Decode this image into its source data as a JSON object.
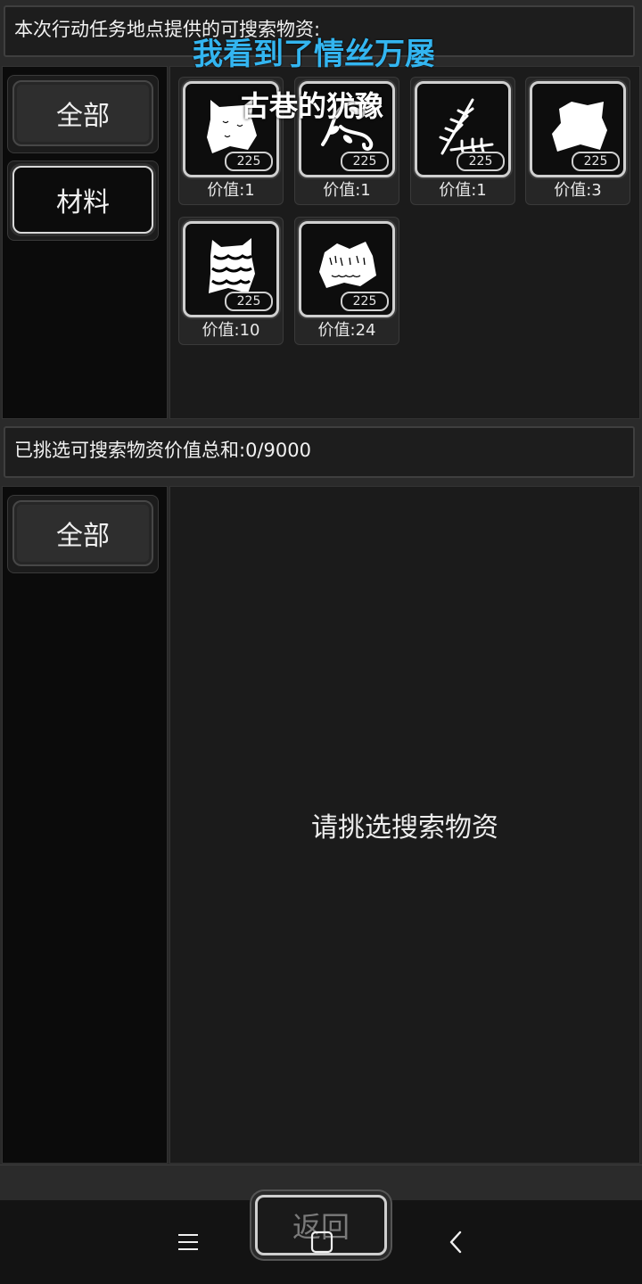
{
  "top_bar": {
    "title": "本次行动任务地点提供的可搜索物资:"
  },
  "overlay": {
    "blue_text": "我看到了情丝万屡",
    "white_text": "古巷的犹豫"
  },
  "source_panel": {
    "categories": [
      {
        "label": "全部",
        "active": false
      },
      {
        "label": "材料",
        "active": true
      }
    ],
    "items": [
      {
        "icon": "white-fur-pelt-icon",
        "count": "225",
        "value": "价值:1"
      },
      {
        "icon": "vine-tendril-icon",
        "count": "225",
        "value": "价值:1"
      },
      {
        "icon": "fern-leaves-icon",
        "count": "225",
        "value": "价值:1"
      },
      {
        "icon": "white-hide-icon",
        "count": "225",
        "value": "价值:3"
      },
      {
        "icon": "striped-pelt-icon",
        "count": "225",
        "value": "价值:10"
      },
      {
        "icon": "furry-hide-icon",
        "count": "225",
        "value": "价值:24"
      }
    ]
  },
  "selected_bar": {
    "title": "已挑选可搜索物资价值总和:0/9000"
  },
  "selected_panel": {
    "categories": [
      {
        "label": "全部",
        "active": false
      }
    ],
    "empty_message": "请挑选搜索物资"
  },
  "footer": {
    "return_label": "返回"
  },
  "navbar": {
    "menu_icon": "menu-icon",
    "home_icon": "home-icon",
    "back_icon": "back-icon"
  }
}
